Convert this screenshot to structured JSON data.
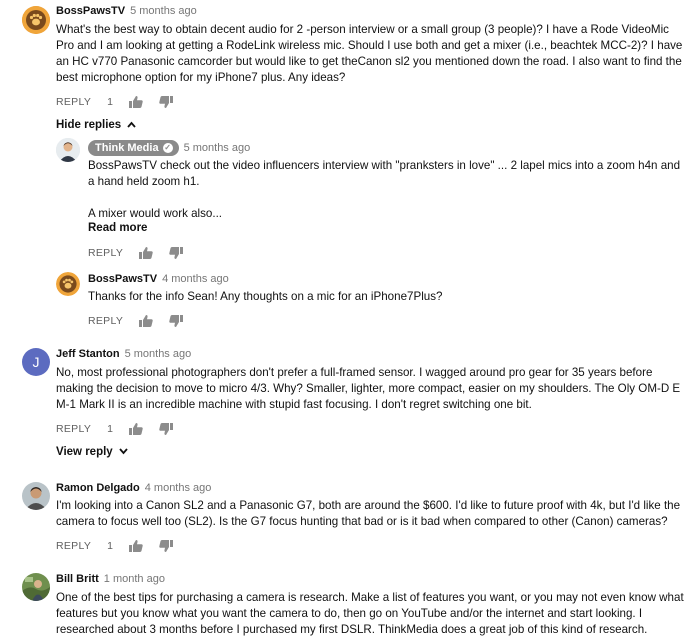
{
  "colors": {
    "badge_bg": "#8a8a8a",
    "meta_gray": "#767676",
    "action_gray": "#606060"
  },
  "comments": [
    {
      "author": "BossPawsTV",
      "time": "5 months ago",
      "lines": [
        "What's the best way to obtain decent audio for 2 -person interview or a small group (3 people)? I have a Rode VideoMic",
        "Pro and I am looking at getting a RodeLink wireless mic. Should I use both and get a mixer (i.e., beachtek MCC-2)? I have",
        "an HC v770 Panasonic camcorder but would like to get theCanon sl2 you mentioned down the road. I also want to find the",
        "best microphone option for my iPhone7 plus. Any ideas?"
      ],
      "reply_label": "REPLY",
      "likes": "1",
      "toggle": "Hide replies",
      "avatar_icon": "dog-paw-avatar"
    },
    {
      "author": "Think Media",
      "time": "5 months ago",
      "lines": [
        "BossPawsTV check out the video influencers interview with \"pranksters in love\" ... 2 lapel mics into a zoom h4n and",
        "a hand held zoom h1.",
        "",
        "A mixer would work also..."
      ],
      "read_more": "Read more",
      "reply_label": "REPLY",
      "avatar_icon": "man-avatar"
    },
    {
      "author": "BossPawsTV",
      "time": "4 months ago",
      "lines": [
        "Thanks for the info Sean! Any thoughts on a mic for an iPhone7Plus?"
      ],
      "reply_label": "REPLY",
      "avatar_icon": "dog-paw-avatar"
    },
    {
      "author": "Jeff Stanton",
      "time": "5 months ago",
      "initial": "J",
      "lines": [
        "No, most professional photographers don't prefer a full-framed sensor. I wagged around pro gear for 35 years before",
        "making the decision to move to micro 4/3. Why? Smaller, lighter, more compact, easier on my shoulders. The Oly OM-D E",
        "M-1 Mark II is an incredible machine with stupid fast focusing. I don't regret switching one bit."
      ],
      "reply_label": "REPLY",
      "likes": "1",
      "toggle": "View reply",
      "avatar_color": "#5c6bc0"
    },
    {
      "author": "Ramon Delgado",
      "time": "4 months ago",
      "lines": [
        "I'm looking into a Canon SL2 and a Panasonic G7, both are around the $600. I'd like to future proof with 4k, but I'd like the",
        "camera to focus well too (SL2). Is the G7 focus hunting that bad or is it bad when compared to other (Canon) cameras?"
      ],
      "reply_label": "REPLY",
      "likes": "1",
      "avatar_icon": "man-avatar"
    },
    {
      "author": "Bill Britt",
      "time": "1 month ago",
      "lines": [
        "One of the best tips for purchasing a camera is research.  Make a list of features you want, or you may not even know what",
        "features but you know what you want the camera to do, then go on YouTube and/or the internet and start looking.  I",
        "researched about 3 months before I purchased my first DSLR.  ThinkMedia does a great job of this kind of research."
      ],
      "avatar_icon": "outdoor-photo-avatar"
    }
  ]
}
